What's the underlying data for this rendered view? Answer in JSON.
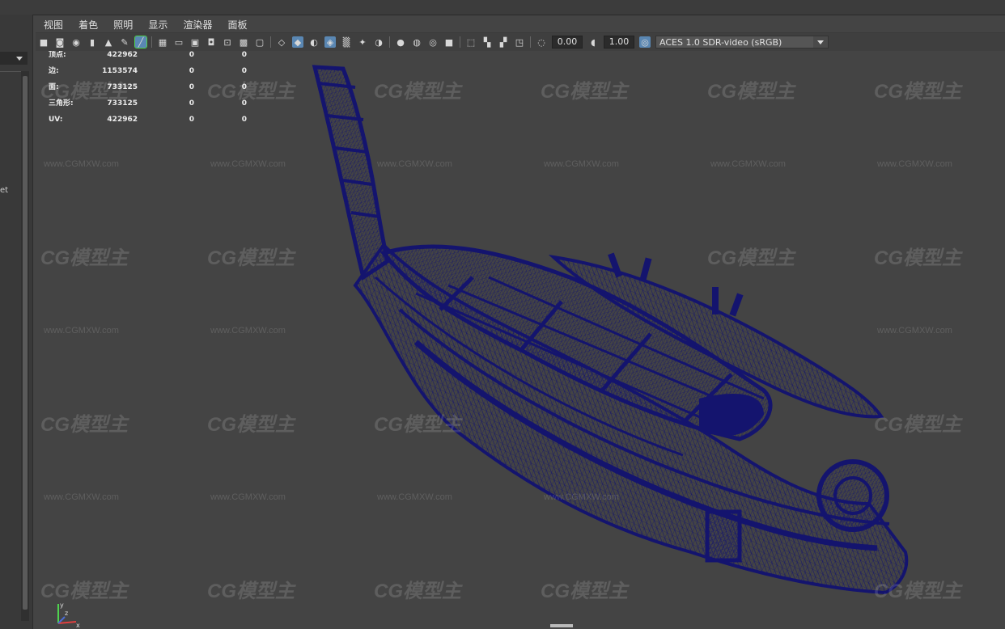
{
  "menu": {
    "items": [
      "视图",
      "着色",
      "照明",
      "显示",
      "渲染器",
      "面板"
    ]
  },
  "left_panel": {
    "fragment": "et"
  },
  "toolbar": {
    "exposure": "0.00",
    "gamma": "1.00",
    "color_space": "ACES 1.0 SDR-video (sRGB)"
  },
  "stats": {
    "rows": [
      {
        "label": "顶点:",
        "v1": "422962",
        "v2": "0",
        "v3": "0"
      },
      {
        "label": "边:",
        "v1": "1153574",
        "v2": "0",
        "v3": "0"
      },
      {
        "label": "面:",
        "v1": "733125",
        "v2": "0",
        "v3": "0"
      },
      {
        "label": "三角形:",
        "v1": "733125",
        "v2": "0",
        "v3": "0"
      },
      {
        "label": "UV:",
        "v1": "422962",
        "v2": "0",
        "v3": "0"
      }
    ]
  },
  "watermark": {
    "logo": "CG模型主",
    "url": "www.CGMXW.com"
  },
  "axis": {
    "x": "x",
    "y": "y",
    "z": "z"
  },
  "colors": {
    "wireframe": "#14146e",
    "background": "#444444",
    "active_tool": "#5a87b3"
  }
}
